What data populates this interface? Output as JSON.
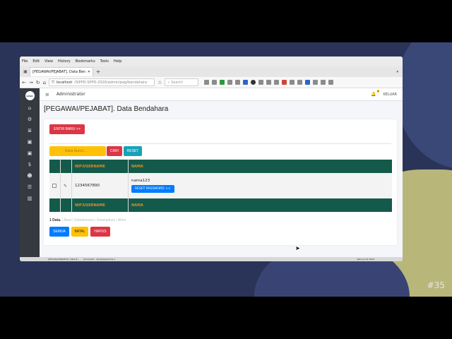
{
  "browser": {
    "menu": [
      "File",
      "Edit",
      "View",
      "History",
      "Bookmarks",
      "Tools",
      "Help"
    ],
    "tab_title": "[PEGAWAI/PEJABAT]. Data Benda",
    "url_host": "localhost",
    "url_path": "/SIPPD-SPPD-2026/admin/peg/bendahara",
    "search_placeholder": "Search"
  },
  "app": {
    "logo_text": "LOGO",
    "user": "Administrator",
    "notif_count": "0",
    "logout": "KELUAR",
    "page_title": "[PEGAWAI/PEJABAT]. Data Bendahara"
  },
  "actions": {
    "new_entry": "ENTRI BARU >>",
    "keyword_placeholder": "Kata Kunci...",
    "search": "CARI",
    "reset": "RESET"
  },
  "table": {
    "columns": [
      "",
      "",
      "NIP/USERNAME",
      "NAMA"
    ],
    "rows": [
      {
        "nip": "1234567890",
        "nama": "nama123",
        "reset_password": "RESET PASSWORD >>"
      }
    ]
  },
  "pager": {
    "count": "1 Data.",
    "links": [
      "Awal",
      "Sebelumnya",
      "Selanjutnya",
      "Akhir"
    ]
  },
  "bulk": {
    "all": "SEMUA",
    "cancel": "BATAL",
    "delete": "HAPUS"
  },
  "taskbar": {
    "window1": "[PEGAWAI/PEJABAT]. Data B...",
    "window2": "[Kompiled - apd@apparatus-1",
    "clock": "Wed Jul 01 2026"
  },
  "desktop_tag": "#35",
  "colors": {
    "table_header": "#145a4a",
    "header_text": "#e08a2a",
    "red": "#dc3545",
    "blue": "#007bff",
    "yellow": "#ffc107",
    "teal": "#17a2b8",
    "sidebar": "#343a40"
  }
}
